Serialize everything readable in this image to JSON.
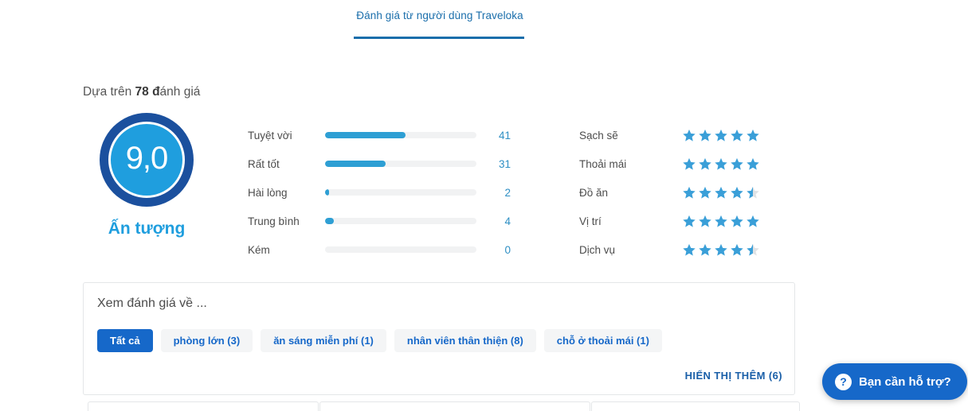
{
  "tab": {
    "label": "Đánh giá từ người dùng Traveloka",
    "active": true,
    "accent_color": "#1a6eab"
  },
  "summary": {
    "heading_prefix": "Dựa trên ",
    "heading_bold": "78 đ",
    "heading_suffix": "ánh giá",
    "score_value": "9,0",
    "score_caption": "Ấn tượng",
    "score_ring_color": "#1b509e",
    "score_fill_color": "#1f9ede"
  },
  "chart_data": {
    "type": "bar",
    "title": "Dựa trên 78 đánh giá",
    "orientation": "horizontal",
    "categories": [
      "Tuyệt vời",
      "Rất tốt",
      "Hài lòng",
      "Trung bình",
      "Kém"
    ],
    "values": [
      41,
      31,
      2,
      4,
      0
    ],
    "total": 78,
    "xlabel": "",
    "ylabel": "",
    "xlim": [
      0,
      78
    ],
    "grid": false,
    "legend": "none",
    "bar_color": "#2e9fd4",
    "track_color": "#f1f2f3",
    "percent_widths": [
      53,
      40,
      3,
      6,
      0
    ],
    "rows": [
      {
        "label": "Tuyệt vời",
        "count": "41",
        "percent": 53
      },
      {
        "label": "Rất tốt",
        "count": "31",
        "percent": 40
      },
      {
        "label": "Hài lòng",
        "count": "2",
        "percent": 3
      },
      {
        "label": "Trung bình",
        "count": "4",
        "percent": 6
      },
      {
        "label": "Kém",
        "count": "0",
        "percent": 0
      }
    ]
  },
  "categories_ratings": {
    "star_color": "#3a9fd8",
    "star_empty_color": "#dfe2e5",
    "max_stars": 5,
    "rows": [
      {
        "label": "Sạch sẽ",
        "stars": 5
      },
      {
        "label": "Thoải mái",
        "stars": 5
      },
      {
        "label": "Đồ ăn",
        "stars": 4.5
      },
      {
        "label": "Vị trí",
        "stars": 5
      },
      {
        "label": "Dịch vụ",
        "stars": 4.5
      }
    ]
  },
  "filter_card": {
    "title": "Xem đánh giá về ...",
    "chips": [
      {
        "label": "Tất cả",
        "active": true
      },
      {
        "label": "phòng lớn (3)",
        "active": false
      },
      {
        "label": "ăn sáng miễn phí (1)",
        "active": false
      },
      {
        "label": "nhân viên thân thiện (8)",
        "active": false
      },
      {
        "label": "chỗ ở thoải mái (1)",
        "active": false
      }
    ],
    "show_more": "HIỂN THỊ THÊM (6)",
    "active_chip_color": "#1668c9",
    "chip_bg_color": "#f4f5f6"
  },
  "help_button": {
    "icon": "question-mark-circle-icon",
    "icon_glyph": "?",
    "label": "Bạn cần hỗ trợ?",
    "color": "#1668c9"
  }
}
